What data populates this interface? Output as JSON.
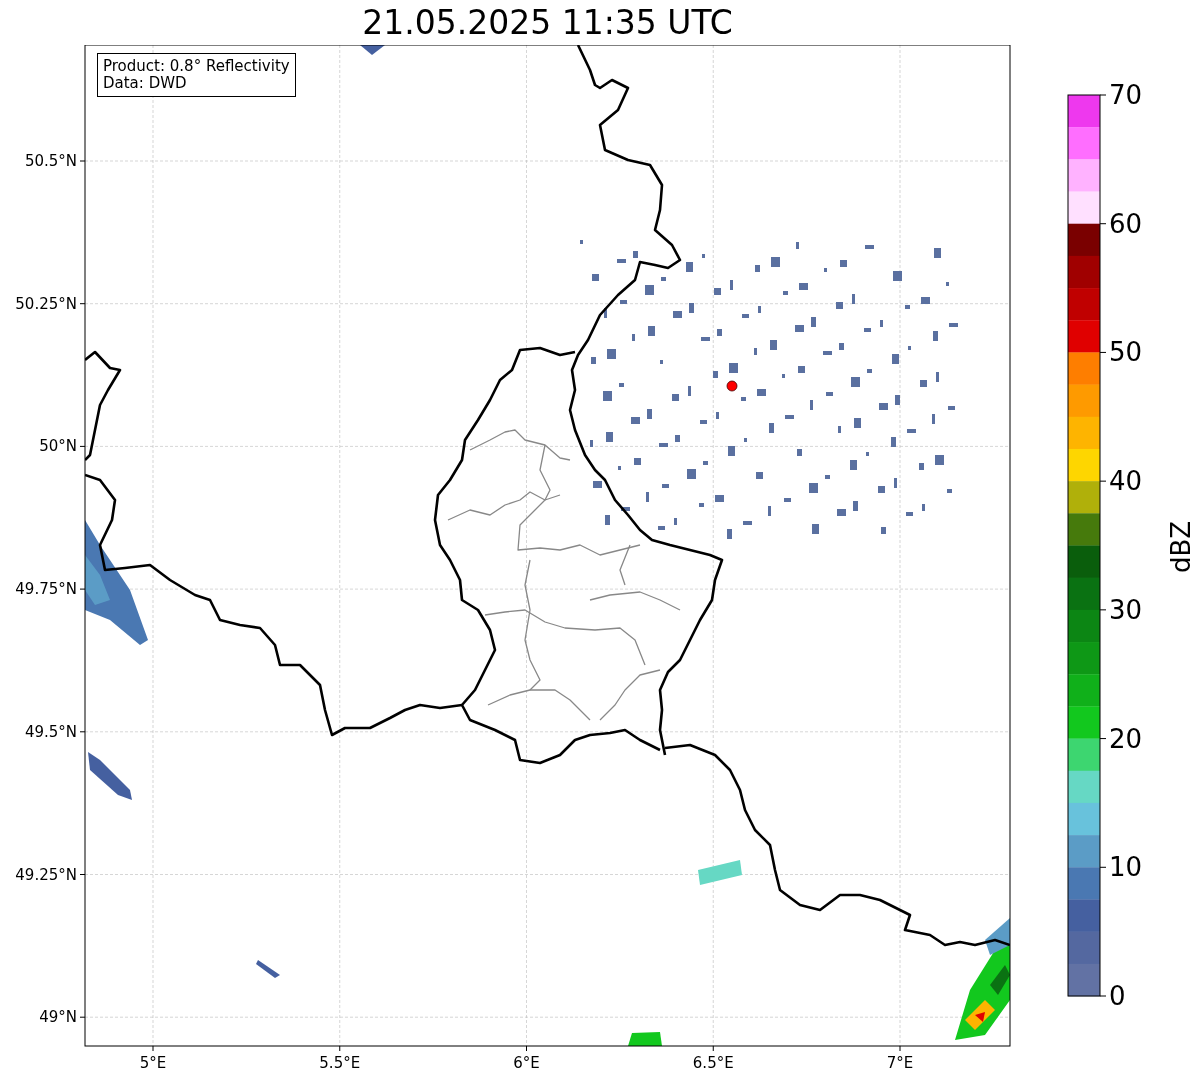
{
  "title": "21.05.2025 11:35 UTC",
  "legend": {
    "lines": [
      "Product: 0.8° Reflectivity",
      "Data: DWD"
    ]
  },
  "map": {
    "x_ticks": [
      "5°E",
      "5.5°E",
      "6°E",
      "6.5°E",
      "7°E"
    ],
    "y_ticks": [
      "50.5°N",
      "50.25°N",
      "50°N",
      "49.75°N",
      "49.5°N",
      "49.25°N",
      "49°N"
    ]
  },
  "colorbar": {
    "label": "dBZ",
    "ticks": [
      "70",
      "60",
      "50",
      "40",
      "30",
      "20",
      "10",
      "0"
    ],
    "segments": [
      {
        "color": "#ee38ee"
      },
      {
        "color": "#ff6eff"
      },
      {
        "color": "#ffb2ff"
      },
      {
        "color": "#ffe0ff"
      },
      {
        "color": "#7a0000"
      },
      {
        "color": "#a00000"
      },
      {
        "color": "#c00000"
      },
      {
        "color": "#e00000"
      },
      {
        "color": "#fe7e00"
      },
      {
        "color": "#fe9a00"
      },
      {
        "color": "#feb400"
      },
      {
        "color": "#fed600"
      },
      {
        "color": "#b0b00a"
      },
      {
        "color": "#467a0c"
      },
      {
        "color": "#0a5e0c"
      },
      {
        "color": "#0a7212"
      },
      {
        "color": "#0c8614"
      },
      {
        "color": "#0e9816"
      },
      {
        "color": "#10b01a"
      },
      {
        "color": "#12c81e"
      },
      {
        "color": "#3dd670"
      },
      {
        "color": "#66d8c4"
      },
      {
        "color": "#68c2dc"
      },
      {
        "color": "#5b9cc6"
      },
      {
        "color": "#4a78b2"
      },
      {
        "color": "#4560a0"
      },
      {
        "color": "#5468a0"
      },
      {
        "color": "#6272a4"
      }
    ]
  }
}
